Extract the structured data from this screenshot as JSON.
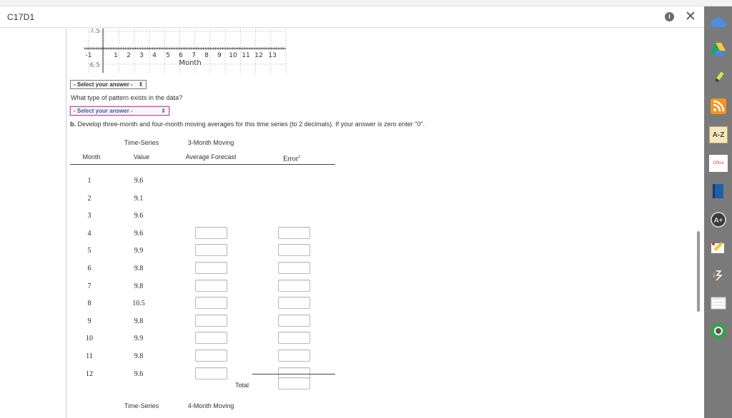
{
  "window": {
    "title": "C17D1"
  },
  "chart_data": {
    "type": "line",
    "xlabel": "Month",
    "x_ticks": [
      "-1",
      "1",
      "2",
      "3",
      "4",
      "5",
      "6",
      "7",
      "8",
      "9",
      "10",
      "11",
      "12",
      "13"
    ],
    "y_ticks": [
      "7.5",
      "6.5"
    ],
    "grid": true
  },
  "chart_text": {
    "xlabel": "Month",
    "y_top": "7.5",
    "y_bottom": "6.5"
  },
  "pattern_select": {
    "value": "- Select your answer -",
    "arrow": "⇕"
  },
  "question": {
    "text": "What type of pattern exists in the data?"
  },
  "pattern_select2": {
    "value": "- Select your answer -",
    "arrow": "⇕"
  },
  "part_b": {
    "prefix": "b.",
    "text": " Develop three-month and four-month moving averages for this time series (to 2 decimals). If your answer is zero enter \"0\"."
  },
  "table3": {
    "headers": {
      "month": "Month",
      "ts_top": "Time-Series",
      "ts_bottom": "Value",
      "ma_top": "3-Month Moving",
      "ma_bottom": "Average Forecast",
      "error": "Error",
      "error_sup": "2"
    },
    "rows": [
      {
        "month": "1",
        "value": "9.6"
      },
      {
        "month": "2",
        "value": "9.1"
      },
      {
        "month": "3",
        "value": "9.6"
      },
      {
        "month": "4",
        "value": "9.6"
      },
      {
        "month": "5",
        "value": "9.9"
      },
      {
        "month": "6",
        "value": "9.8"
      },
      {
        "month": "7",
        "value": "9.8"
      },
      {
        "month": "8",
        "value": "10.5"
      },
      {
        "month": "9",
        "value": "9.8"
      },
      {
        "month": "10",
        "value": "9.9"
      },
      {
        "month": "11",
        "value": "9.8"
      },
      {
        "month": "12",
        "value": "9.6"
      }
    ],
    "total_label": "Total"
  },
  "table4": {
    "ts_top": "Time-Series",
    "ma_top": "4-Month Moving"
  },
  "sidebar": {
    "items": [
      "cloud-icon",
      "drive-icon",
      "highlighter-icon",
      "rss-icon",
      "a-z-icon",
      "office-icon",
      "book-icon",
      "a-plus-icon",
      "pencil-paper-icon",
      "speech-icon",
      "notepad-icon",
      "circle-icon"
    ],
    "az_label": "A-Z",
    "office_label": "Office",
    "aplus_label": "A+"
  }
}
